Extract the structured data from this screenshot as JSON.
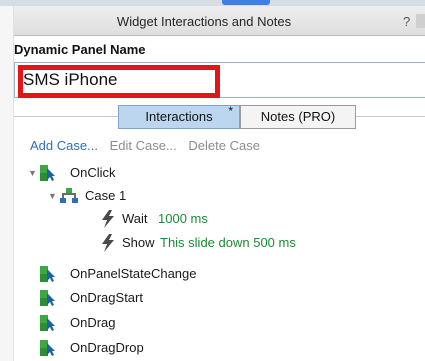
{
  "window": {
    "title": "Widget Interactions and Notes",
    "help": "?"
  },
  "panel_name": {
    "label": "Dynamic Panel Name",
    "value": "SMS iPhone"
  },
  "tabs": [
    {
      "label": "Interactions",
      "badge": "*"
    },
    {
      "label": "Notes (PRO)"
    }
  ],
  "actions": {
    "add": "Add Case...",
    "edit": "Edit Case...",
    "delete": "Delete Case"
  },
  "tree": {
    "onclick": "OnClick",
    "case1": "Case 1",
    "wait": {
      "verb": "Wait",
      "detail": "1000 ms"
    },
    "show": {
      "verb": "Show",
      "detail": "This slide down 500 ms"
    },
    "events": [
      "OnPanelStateChange",
      "OnDragStart",
      "OnDrag",
      "OnDragDrop"
    ]
  },
  "colors": {
    "highlight": "#e3141a",
    "link": "#2f6fb5",
    "action_detail": "#1e8a36",
    "tab_active": "#bcd6ef"
  }
}
